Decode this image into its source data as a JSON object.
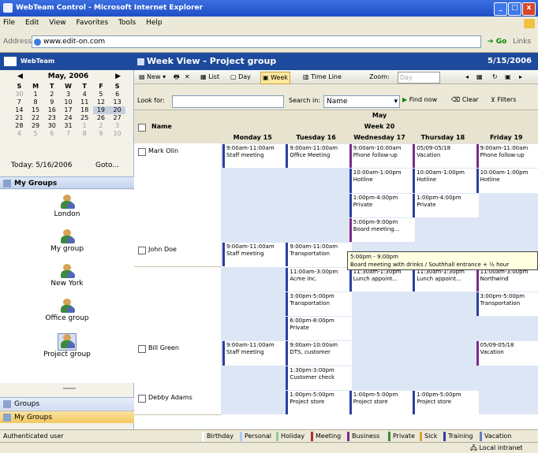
{
  "window": {
    "title": "WebTeam Control - Microsoft Internet Explorer",
    "buttons": [
      "_",
      "□",
      "x"
    ]
  },
  "menubar": [
    "File",
    "Edit",
    "View",
    "Favorites",
    "Tools",
    "Help"
  ],
  "address": {
    "label": "Address",
    "value": "www.edit-on.com",
    "go": "Go",
    "links": "Links"
  },
  "brand": "WebTeam",
  "mini_calendar": {
    "month": "May, 2006",
    "prev": "◀",
    "next": "▶",
    "dow": [
      "S",
      "M",
      "T",
      "W",
      "T",
      "F",
      "S"
    ],
    "weeks": [
      [
        "30",
        "1",
        "2",
        "3",
        "4",
        "5",
        "6"
      ],
      [
        "7",
        "8",
        "9",
        "10",
        "11",
        "12",
        "13"
      ],
      [
        "14",
        "15",
        "16",
        "17",
        "18",
        "19",
        "20"
      ],
      [
        "21",
        "22",
        "23",
        "24",
        "25",
        "26",
        "27"
      ],
      [
        "28",
        "29",
        "30",
        "31",
        "1",
        "2",
        "3"
      ],
      [
        "4",
        "5",
        "6",
        "7",
        "8",
        "9",
        "10"
      ]
    ],
    "today_label": "Today: 5/16/2006",
    "goto_label": "Goto..."
  },
  "groups_header": "My Groups",
  "groups": [
    "London",
    "My group",
    "New York",
    "Office group",
    "Project group"
  ],
  "nav": {
    "groups": "Groups",
    "my_groups": "My Groups"
  },
  "main": {
    "title": "Week View - Project group",
    "date": "5/15/2006"
  },
  "toolbar": {
    "new": "New",
    "list": "List",
    "day": "Day",
    "week": "Week",
    "timeline": "Time Line",
    "zoom": "Zoom:",
    "zoom_value": "Day"
  },
  "search": {
    "look_for": "Look for:",
    "search_in": "Search in:",
    "search_in_value": "Name",
    "find_now": "Find now",
    "clear": "Clear",
    "filters": "Filters"
  },
  "calendar": {
    "month": "May",
    "week": "Week 20",
    "name_header": "Name",
    "days": [
      "Monday 15",
      "Tuesday 16",
      "Wednesday 17",
      "Thursday 18",
      "Friday 19"
    ],
    "people": [
      "Mark Olin",
      "John Doe",
      "Bill Green",
      "Debby Adams"
    ]
  },
  "appointments": {
    "a1": {
      "time": "9:00am-11:00am",
      "text": "Staff meeting"
    },
    "a2": {
      "time": "9:00am-11:00am",
      "text": "Office Meeting"
    },
    "a3": {
      "time": "9:00am-10:00am",
      "text": "Phone follow-up"
    },
    "a4": {
      "time": "05/09-05/18",
      "text": "Vacation"
    },
    "a5": {
      "time": "9:00am-11:00am",
      "text": "Phone follow-up"
    },
    "a6": {
      "time": "10:00am-1:00pm",
      "text": "Hotline"
    },
    "a7": {
      "time": "10:00am-1:00pm",
      "text": "Hotline"
    },
    "a8": {
      "time": "10:00am-1:00pm",
      "text": "Hotline"
    },
    "a9": {
      "time": "1:00pm-4:00pm",
      "text": "Private"
    },
    "a10": {
      "time": "1:00pm-4:00pm",
      "text": "Private"
    },
    "a11": {
      "time": "5:00pm-9:00pm",
      "text": "Board meeting..."
    },
    "a12": {
      "time": "9:00am-11:00am",
      "text": "Staff meeting"
    },
    "a13": {
      "time": "9:00am-11:00am",
      "text": "Transportation"
    },
    "a14": {
      "time": "11:00am-3:00pm",
      "text": "Acme Inc."
    },
    "a15": {
      "time": "11:30am-1:30pm",
      "text": "Lunch appoint..."
    },
    "a16": {
      "time": "11:30am-1:30pm",
      "text": "Lunch appoint..."
    },
    "a17": {
      "time": "11:00am-3:00pm",
      "text": "Northwind"
    },
    "a18": {
      "time": "3:00pm-5:00pm",
      "text": "Transportation"
    },
    "a19": {
      "time": "3:00pm-5:00pm",
      "text": "Transportation"
    },
    "a20": {
      "time": "6:00pm-8:00pm",
      "text": "Private"
    },
    "a21": {
      "time": "9:00am-11:00am",
      "text": "Staff meeting"
    },
    "a22": {
      "time": "9:00am-10:00am",
      "text": "DTS, customer"
    },
    "a23": {
      "time": "05/09-05/18",
      "text": "Vacation"
    },
    "a24": {
      "time": "1:30pm-3:00pm",
      "text": "Customer check"
    },
    "a25": {
      "time": "1:00pm-5:00pm",
      "text": "Project store"
    },
    "a26": {
      "time": "1:00pm-5:00pm",
      "text": "Project store"
    },
    "a27": {
      "time": "1:00pm-5:00pm",
      "text": "Project store"
    }
  },
  "tooltip": {
    "line1": "5:00pm - 9:00pm",
    "line2": "Board meeting with drinks / Southhall entrance + ½ hour"
  },
  "status": {
    "left": "Authenticated user",
    "legend": [
      "Birthday",
      "Personal",
      "Holiday",
      "Meeting",
      "Business",
      "Private",
      "Sick",
      "Training",
      "Vacation"
    ],
    "legend_colors": [
      "#ffffff",
      "#b0c8ff",
      "#8fd08f",
      "#b52c2c",
      "#7a2b8a",
      "#3b8a3b",
      "#e0a030",
      "#2c3fa0",
      "#6080c0"
    ],
    "zone": "Local intranet"
  }
}
